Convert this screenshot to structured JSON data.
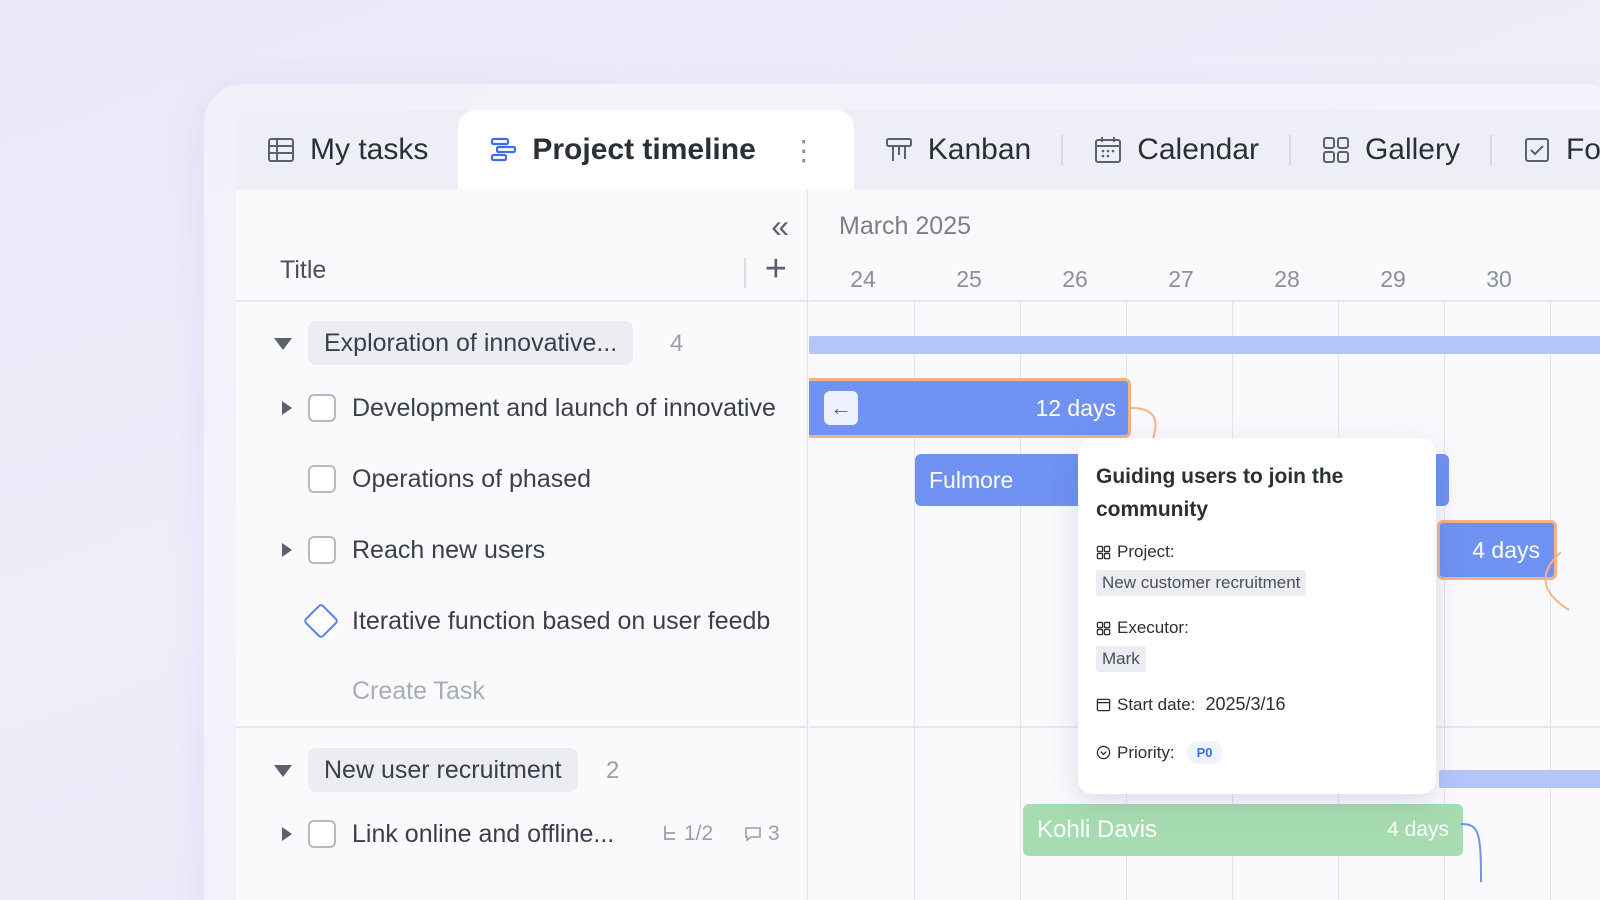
{
  "tabs": [
    {
      "label": "My tasks",
      "icon": "table-icon"
    },
    {
      "label": "Project timeline",
      "icon": "timeline-icon",
      "active": true
    },
    {
      "label": "Kanban",
      "icon": "kanban-icon"
    },
    {
      "label": "Calendar",
      "icon": "calendar-icon"
    },
    {
      "label": "Gallery",
      "icon": "gallery-icon"
    },
    {
      "label": "Fo",
      "icon": "form-icon"
    }
  ],
  "left": {
    "title_header": "Title",
    "groups": [
      {
        "name": "Exploration of innovative...",
        "count": "4",
        "tasks": [
          {
            "label": "Development and launch of innovative",
            "expandable": true,
            "type": "checkbox"
          },
          {
            "label": "Operations of phased",
            "expandable": false,
            "type": "checkbox"
          },
          {
            "label": "Reach new users",
            "expandable": true,
            "type": "checkbox"
          },
          {
            "label": "Iterative function based on user feedb",
            "expandable": false,
            "type": "milestone"
          }
        ],
        "create_label": "Create Task"
      },
      {
        "name": "New user recruitment",
        "count": "2",
        "tasks": [
          {
            "label": "Link online and offline...",
            "expandable": true,
            "type": "checkbox",
            "subtasks": "1/2",
            "comments": "3"
          }
        ]
      }
    ]
  },
  "timeline": {
    "month": "March 2025",
    "days": [
      "24",
      "25",
      "26",
      "27",
      "28",
      "29",
      "30"
    ],
    "bars": {
      "dev_duration": "12 days",
      "ops_assignee": "Fulmore",
      "reach_duration": "4 days",
      "link_assignee": "Kohli Davis",
      "link_duration": "4 days"
    }
  },
  "tooltip": {
    "title": "Guiding users to join the community",
    "project_label": "Project:",
    "project_value": "New customer recruitment",
    "executor_label": "Executor:",
    "executor_value": "Mark",
    "start_label": "Start date:",
    "start_value": "2025/3/16",
    "priority_label": "Priority:",
    "priority_value": "P0"
  },
  "colors": {
    "accent": "#5b7ff0",
    "bar_blue": "#6f92f3",
    "bar_orange_border": "#f0b48a",
    "bar_green": "#a7dcb0",
    "summary_bar": "#b3c6fa"
  }
}
